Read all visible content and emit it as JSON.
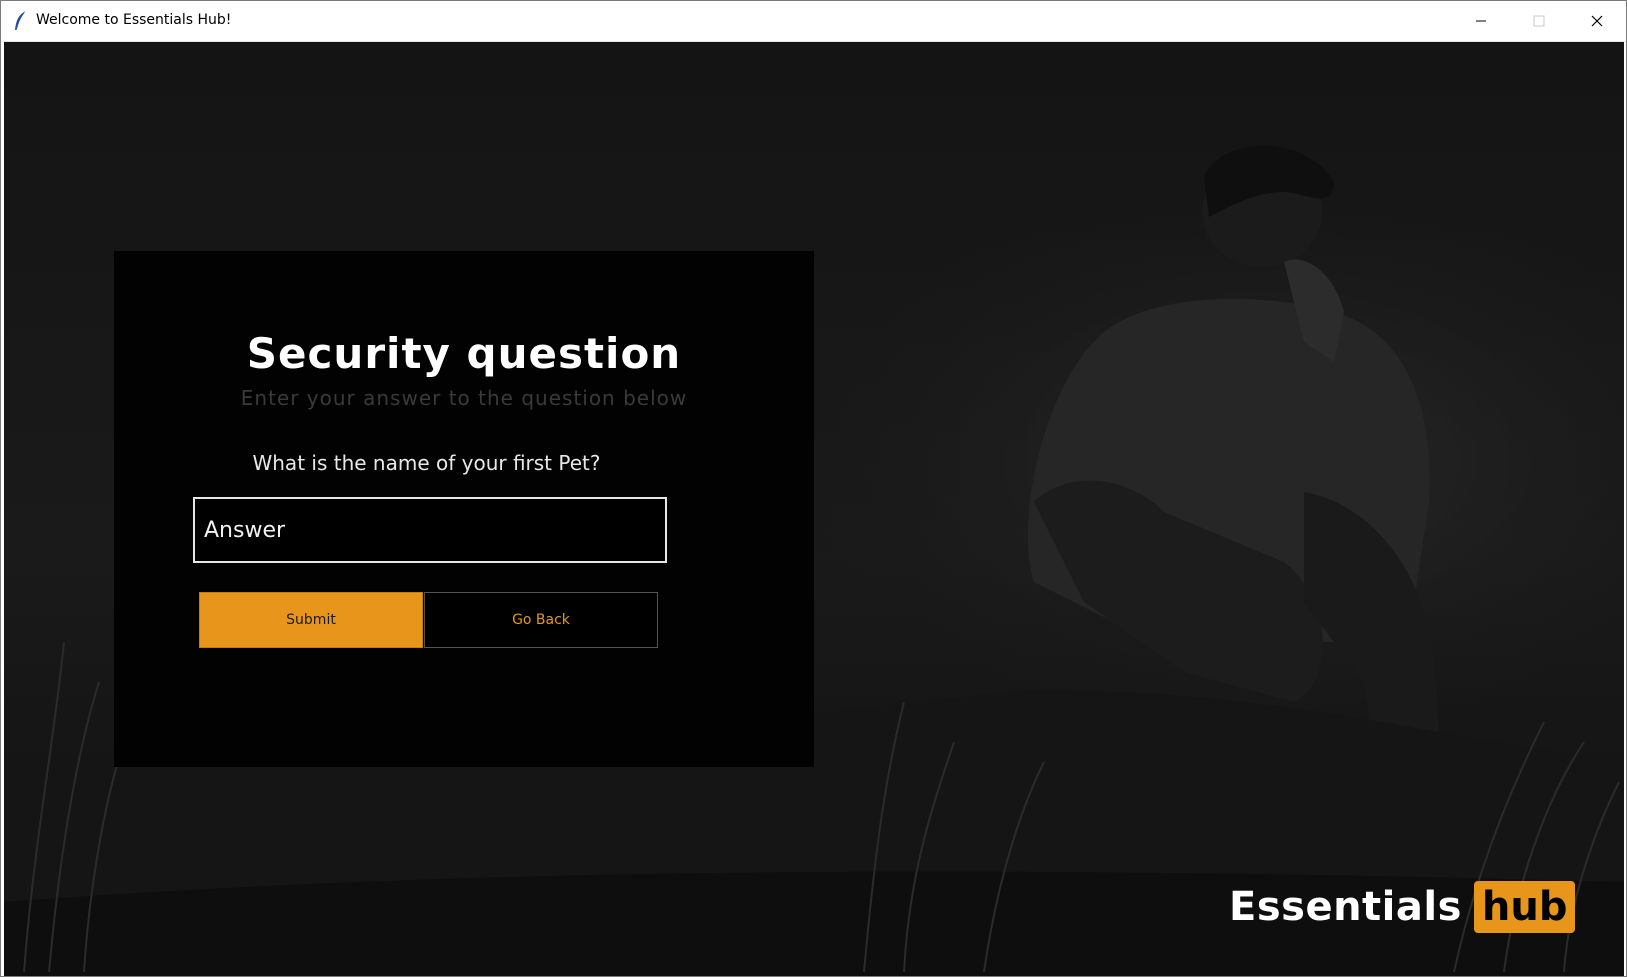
{
  "window": {
    "title": "Welcome to Essentials Hub!",
    "controls": {
      "minimize_icon": "minimize-icon",
      "maximize_icon": "maximize-icon",
      "close_icon": "close-icon"
    }
  },
  "panel": {
    "title": "Security question",
    "subtitle": "Enter your answer to the question below",
    "question": "What is the name of your first Pet?",
    "answer_value": "",
    "answer_placeholder": "Answer",
    "submit_label": "Submit",
    "back_label": "Go Back"
  },
  "brand": {
    "word": "Essentials",
    "badge": "hub"
  },
  "colors": {
    "accent": "#e8961b",
    "panel_bg": "#020202",
    "background": "#121212"
  }
}
